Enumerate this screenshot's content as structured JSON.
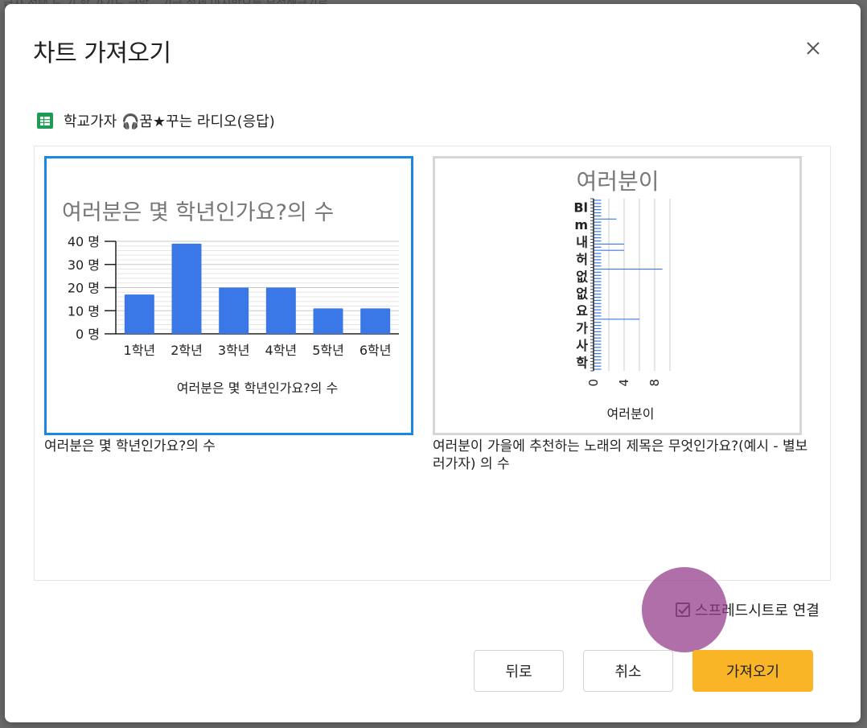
{
  "backdrop": {
    "text": "급자     선택    드 기   합 가기드    급말     _ 기급 설제 마시받으를 무성해급기로"
  },
  "dialog": {
    "title": "차트 가져오기",
    "source": {
      "name": "학교가자 🎧꿈★꾸는 라디오(응답)",
      "icon": "google-sheets-icon"
    },
    "charts": [
      {
        "caption": "여러분은 몇 학년인가요?의 수",
        "selected": true,
        "chart_data": {
          "type": "bar",
          "title": "여러분은 몇 학년인가요?의 수",
          "xlabel": "여러분은 몇 학년인가요?의 수",
          "ylabel": "",
          "categories": [
            "1학년",
            "2학년",
            "3학년",
            "4학년",
            "5학년",
            "6학년"
          ],
          "values": [
            17,
            39,
            20,
            20,
            11,
            11
          ],
          "ylim": [
            0,
            40
          ],
          "yticks": [
            "0 명",
            "10 명",
            "20 명",
            "30 명",
            "40 명"
          ],
          "ytick_values": [
            0,
            10,
            20,
            30,
            40
          ],
          "grid": true,
          "color": "#3b78e7"
        }
      },
      {
        "caption": "여러분이 가을에 추천하는 노래의 제목은 무엇인가요?(예시 - 별보러가자) 의 수",
        "selected": false,
        "chart_data": {
          "type": "bar",
          "orientation": "horizontal",
          "title": "여러분이",
          "xlabel": "여러분이",
          "categories": [
            "Bl",
            "m",
            "내",
            "허",
            "없",
            "없",
            "요",
            "가",
            "사",
            "학"
          ],
          "xticks": [
            "0",
            "4",
            "8"
          ],
          "xtick_values": [
            0,
            4,
            8
          ],
          "xlim": [
            0,
            10
          ],
          "values": [
            1,
            1,
            1,
            1,
            1,
            1,
            3,
            1,
            1,
            1,
            1,
            1,
            1,
            1,
            4,
            1,
            4,
            1,
            1,
            1,
            1,
            1,
            9,
            1,
            1,
            1,
            1,
            1,
            1,
            1,
            1,
            1,
            1,
            1,
            1,
            1,
            1,
            1,
            6,
            1,
            1,
            1,
            1,
            1,
            1,
            1,
            1,
            1,
            1,
            1,
            1,
            1,
            1,
            1,
            1
          ],
          "grid": true,
          "color": "#3b78e7"
        }
      }
    ],
    "connect_label": "스프레드시트로 연결",
    "connect_checked": true,
    "buttons": {
      "back": "뒤로",
      "cancel": "취소",
      "import": "가져오기"
    },
    "colors": {
      "accent": "#f9b526",
      "selection": "#1a88e0",
      "bar": "#3b78e7"
    }
  }
}
